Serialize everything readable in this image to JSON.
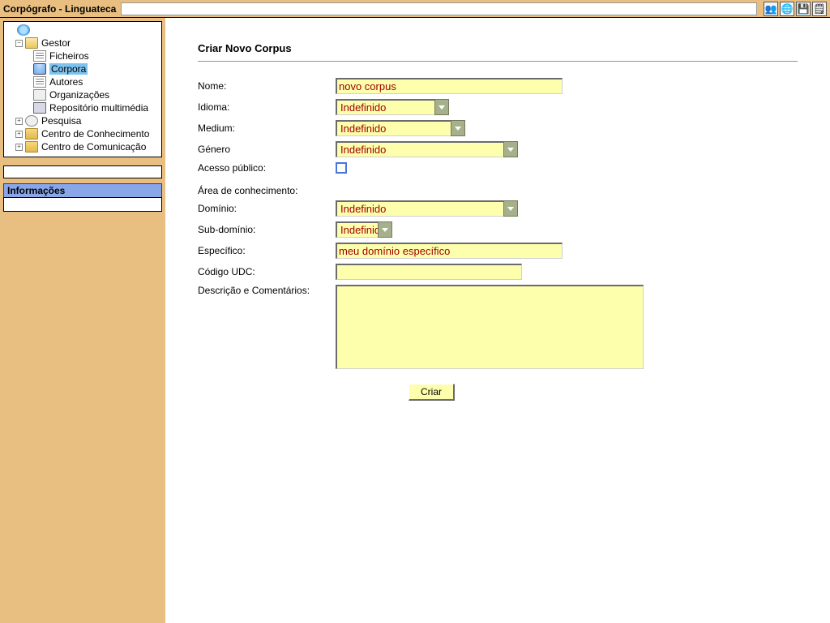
{
  "header": {
    "title": "Corpógrafo - Linguateca",
    "search_value": ""
  },
  "toolbar_icons": [
    "users-icon",
    "globe-icon",
    "disk-icon",
    "note-icon"
  ],
  "tree": {
    "gestor": "Gestor",
    "ficheiros": "Ficheiros",
    "corpora": "Corpora",
    "autores": "Autores",
    "organizacoes": "Organizações",
    "repositorio": "Repositório multimédia",
    "pesquisa": "Pesquisa",
    "centro_conhecimento": "Centro de Conhecimento",
    "centro_comunicacao": "Centro de Comunicação"
  },
  "info_panel_title": "Informações",
  "page": {
    "title": "Criar Novo Corpus",
    "labels": {
      "nome": "Nome:",
      "idioma": "Idioma:",
      "medium": "Medium:",
      "genero": "Género",
      "acesso_publico": "Acesso público:",
      "area": "Área de conhecimento:",
      "dominio": "Domínio:",
      "subdominio": "Sub-domínio:",
      "especifico": "Específico:",
      "codigo_udc": "Código UDC:",
      "descricao": "Descrição e Comentários:"
    },
    "values": {
      "nome": "novo corpus",
      "idioma": "Indefinido",
      "medium": "Indefinido",
      "genero": "Indefinido",
      "dominio": "Indefinido",
      "subdominio": "Indefinido",
      "especifico": "meu domínio específico",
      "codigo_udc": "",
      "descricao": ""
    },
    "submit": "Criar"
  }
}
